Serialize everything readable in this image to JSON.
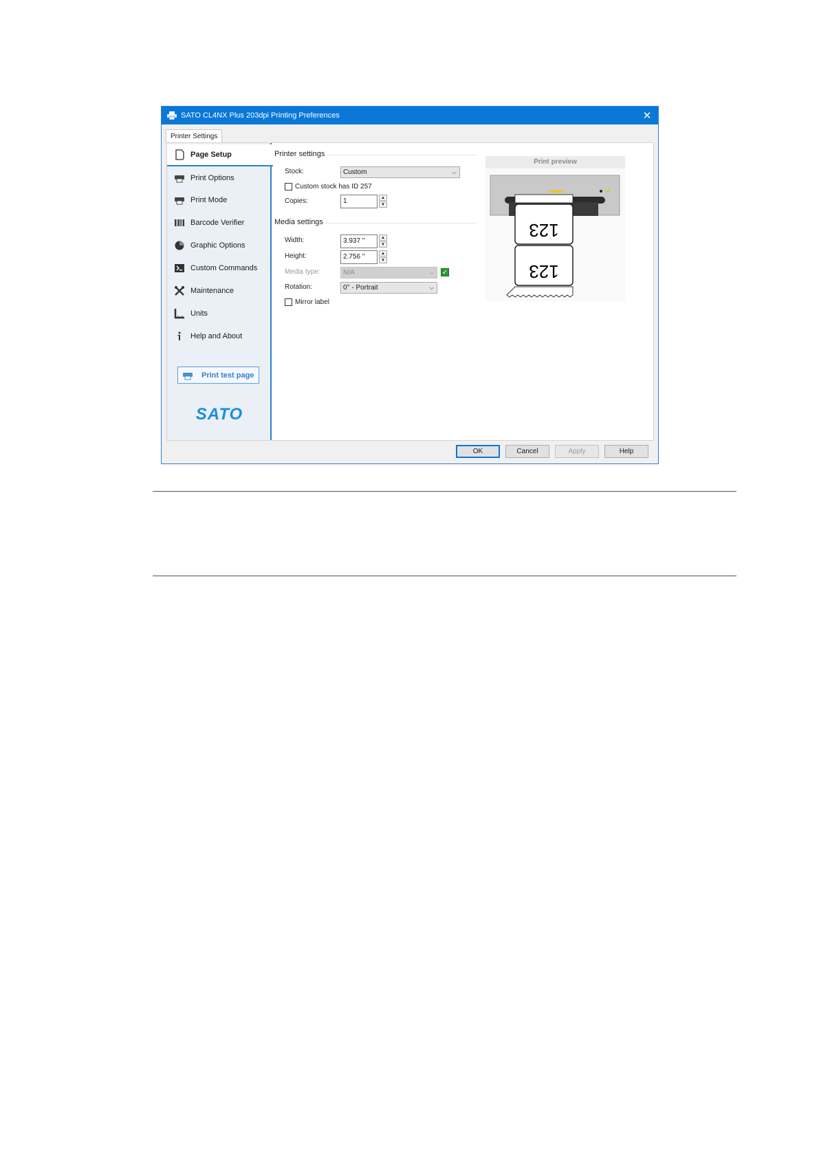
{
  "window": {
    "title": "SATO CL4NX Plus 203dpi Printing Preferences",
    "close_symbol": "✕"
  },
  "tabs": [
    {
      "label": "Printer Settings"
    }
  ],
  "sidebar": {
    "items": [
      {
        "label": "Page Setup",
        "icon": "page-icon",
        "active": true
      },
      {
        "label": "Print Options",
        "icon": "printer-icon"
      },
      {
        "label": "Print Mode",
        "icon": "printer-icon"
      },
      {
        "label": "Barcode Verifier",
        "icon": "barcode-icon"
      },
      {
        "label": "Graphic Options",
        "icon": "pie-icon"
      },
      {
        "label": "Custom Commands",
        "icon": "terminal-icon"
      },
      {
        "label": "Maintenance",
        "icon": "tools-icon"
      },
      {
        "label": "Units",
        "icon": "ruler-icon"
      },
      {
        "label": "Help and About",
        "icon": "info-icon"
      }
    ],
    "test_button": "Print test page",
    "logo_text": "SATO"
  },
  "printer_settings": {
    "heading": "Printer settings",
    "stock_label": "Stock:",
    "stock_value": "Custom",
    "custom_stock_label": "Custom stock has ID 257",
    "copies_label": "Copies:",
    "copies_value": "1"
  },
  "media_settings": {
    "heading": "Media settings",
    "width_label": "Width:",
    "width_value": "3.937 \"",
    "height_label": "Height:",
    "height_value": "2.756 \"",
    "media_type_label": "Media type:",
    "media_type_value": "N/A",
    "rotation_label": "Rotation:",
    "rotation_value": "0° - Portrait",
    "mirror_label": "Mirror label"
  },
  "preview": {
    "heading": "Print preview",
    "label_text": "123"
  },
  "buttons": {
    "ok": "OK",
    "cancel": "Cancel",
    "apply": "Apply",
    "help": "Help"
  },
  "colors": {
    "titlebar": "#0a78d7",
    "accent": "#2c7fce",
    "logo": "#1b8fd8"
  }
}
